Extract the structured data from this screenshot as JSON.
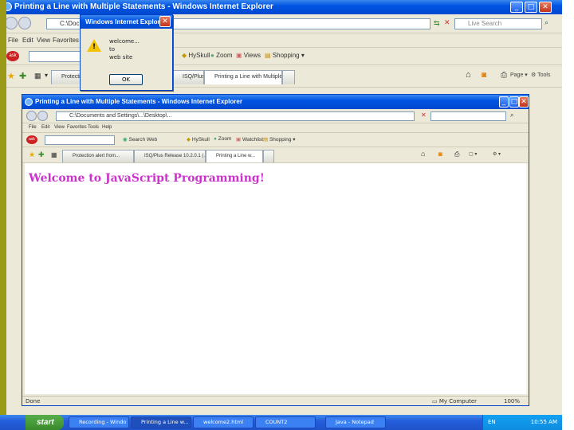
{
  "outer_window": {
    "title": "Printing a Line with Multiple Statements - Windows Internet Explorer",
    "address": "C:\\Documents",
    "search_placeholder": "Live Search",
    "menu": [
      "File",
      "Edit",
      "View",
      "Favorites"
    ],
    "toolbar": [
      "HySkull",
      "Zoom",
      "Views",
      "Shopping"
    ],
    "tabs": [
      "Protection",
      "ISQ/Plus Release 10.2.0.1 (...",
      "Printing a Line with Multiple..."
    ],
    "right_tools": [
      "Page",
      "Tools"
    ]
  },
  "dialog": {
    "title": "Windows Internet Explorer",
    "message_lines": [
      "welcome...",
      "to",
      "web site"
    ],
    "ok_label": "OK"
  },
  "inner_window": {
    "title": "Printing a Line with Multiple Statements - Windows Internet Explorer",
    "address": "C:\\Documents and Settings\\...\\Desktop\\...",
    "menu": [
      "File",
      "Edit",
      "View",
      "Favorites",
      "Tools",
      "Help"
    ],
    "toolbar": [
      "Search Web",
      "HySkull",
      "Zoom",
      "Watchlist",
      "Shopping"
    ],
    "tabs": [
      "Protection alert from...",
      "ISQ/Plus Release 10.2.0.1 (...",
      "Printing a Line w..."
    ],
    "page_text": "Welcome to JavaScript Programming!",
    "status_left": "Done",
    "status_right": "My Computer",
    "zoom": "100%"
  },
  "taskbar": {
    "start_label": "start",
    "tasks": [
      "Recording - Windo",
      "Printing a Line w...",
      "welcome2.html",
      "COUNT2",
      "Java - Notepad"
    ],
    "tray_time": "10:55 AM",
    "language": "EN"
  },
  "colors": {
    "xp_title": "#0054e3",
    "page_text": "#cc33cc",
    "taskbar": "#245edb",
    "start": "#3a8a2c"
  }
}
